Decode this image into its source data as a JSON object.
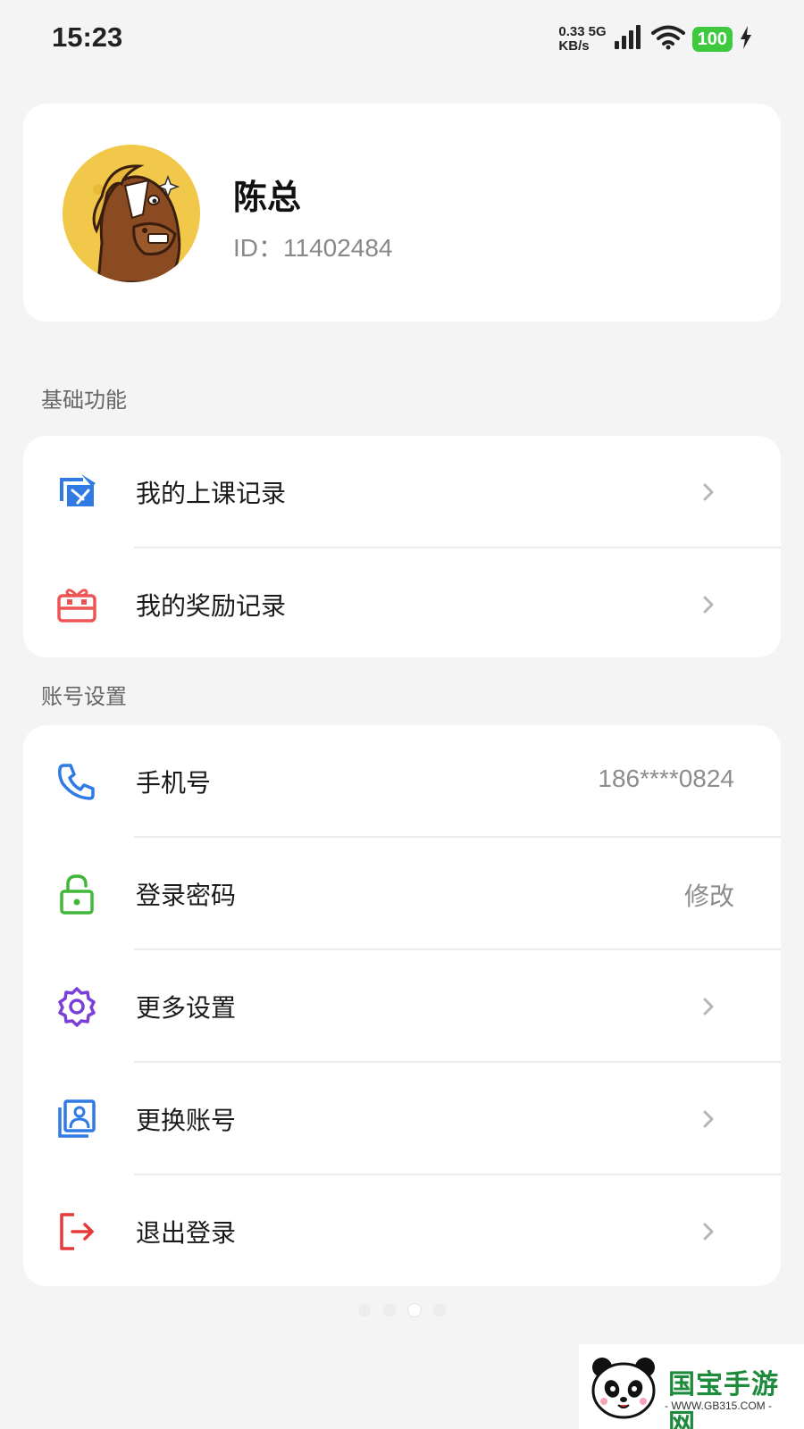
{
  "status_bar": {
    "time": "15:23",
    "net_speed_value": "0.33",
    "net_type": "5G",
    "net_speed_unit": "KB/s",
    "battery": "100"
  },
  "profile": {
    "name": "陈总",
    "id_text": "ID：11402484",
    "avatar_icon": "horse-avatar"
  },
  "sections": {
    "basic_title": "基础功能",
    "account_title": "账号设置"
  },
  "basic_items": [
    {
      "label": "我的上课记录",
      "icon": "class-record-icon",
      "color": "#2f7ae5"
    },
    {
      "label": "我的奖励记录",
      "icon": "gift-icon",
      "color": "#ef5454"
    }
  ],
  "account_items": [
    {
      "label": "手机号",
      "value": "186****0824",
      "icon": "phone-icon",
      "color": "#2f7ae5"
    },
    {
      "label": "登录密码",
      "value": "修改",
      "icon": "lock-icon",
      "color": "#42b83a"
    },
    {
      "label": "更多设置",
      "icon": "gear-icon",
      "color": "#7a3fd6"
    },
    {
      "label": "更换账号",
      "icon": "switch-account-icon",
      "color": "#2f7ae5"
    },
    {
      "label": "退出登录",
      "icon": "logout-icon",
      "color": "#e53a3a"
    }
  ],
  "watermark": {
    "title": "国宝手游网",
    "url": "- WWW.GB315.COM -"
  }
}
